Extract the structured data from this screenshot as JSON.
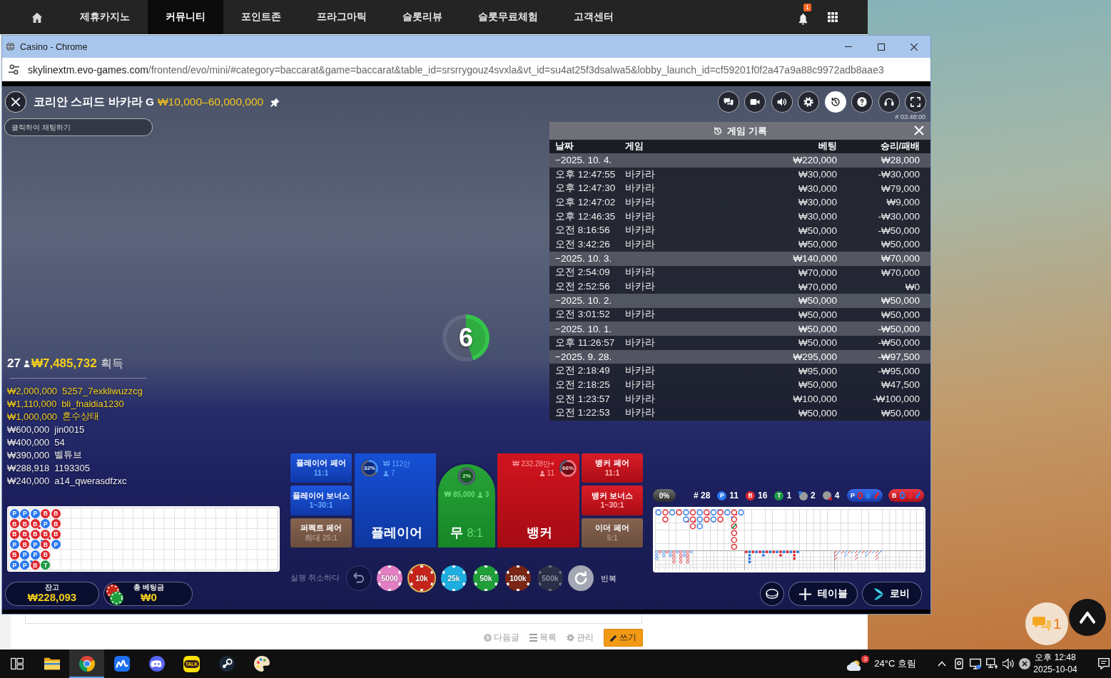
{
  "site_nav": {
    "items": [
      {
        "kind": "home",
        "selected": false
      },
      {
        "kind": "link",
        "label": "제휴카지노",
        "selected": false
      },
      {
        "kind": "link",
        "label": "커뮤니티",
        "selected": true
      },
      {
        "kind": "link",
        "label": "포인트존",
        "selected": false
      },
      {
        "kind": "link",
        "label": "프라그마틱",
        "selected": false
      },
      {
        "kind": "link",
        "label": "슬롯리뷰",
        "selected": false
      },
      {
        "kind": "link",
        "label": "슬롯무료체험",
        "selected": false
      },
      {
        "kind": "link",
        "label": "고객센터",
        "selected": false
      }
    ],
    "notification_count": "1"
  },
  "browser": {
    "title": "Casino - Chrome",
    "url": {
      "host": "skylinextm.evo-games.com",
      "path": "/frontend/evo/mini/#category=baccarat&game=baccarat&table_id=srsrrygouz4svxla&vt_id=su4at25f3dsalwa5&lobby_launch_id=cf59201f0f2a47a9a88c9972adb8aae3"
    }
  },
  "game": {
    "title": "코리안 스피드 바카라 G",
    "limits": "₩10,000–60,000,000",
    "toolbar": [
      {
        "kind": "chat",
        "selected": false
      },
      {
        "kind": "video",
        "selected": false
      },
      {
        "kind": "sound",
        "selected": false
      },
      {
        "kind": "settings",
        "selected": false
      },
      {
        "kind": "history",
        "selected": true
      },
      {
        "kind": "help",
        "selected": false
      },
      {
        "kind": "support",
        "selected": false
      },
      {
        "kind": "fullscreen",
        "selected": false
      }
    ],
    "round_id": "# 03:48:00",
    "chat_input": {
      "placeholder": "클릭하여 채팅하기"
    },
    "history": {
      "title": "게임 기록",
      "columns": [
        "날짜",
        "게임",
        "베팅",
        "승리/패배"
      ],
      "rows": [
        {
          "kind": "date",
          "date": "−2025. 10. 4.",
          "bet": "₩220,000",
          "result": "₩28,000"
        },
        {
          "kind": "game",
          "time": "오후 12:47:55",
          "game": "바카라",
          "bet": "₩30,000",
          "result": "-₩30,000"
        },
        {
          "kind": "game",
          "time": "오후 12:47:30",
          "game": "바카라",
          "bet": "₩30,000",
          "result": "₩79,000"
        },
        {
          "kind": "game",
          "time": "오후 12:47:02",
          "game": "바카라",
          "bet": "₩30,000",
          "result": "₩9,000"
        },
        {
          "kind": "game",
          "time": "오후 12:46:35",
          "game": "바카라",
          "bet": "₩30,000",
          "result": "-₩30,000"
        },
        {
          "kind": "game",
          "time": "오전 8:16:56",
          "game": "바카라",
          "bet": "₩50,000",
          "result": "-₩50,000"
        },
        {
          "kind": "game",
          "time": "오전 3:42:26",
          "game": "바카라",
          "bet": "₩50,000",
          "result": "₩50,000"
        },
        {
          "kind": "date",
          "date": "−2025. 10. 3.",
          "bet": "₩140,000",
          "result": "₩70,000"
        },
        {
          "kind": "game",
          "time": "오전 2:54:09",
          "game": "바카라",
          "bet": "₩70,000",
          "result": "₩70,000"
        },
        {
          "kind": "game",
          "time": "오전 2:52:56",
          "game": "바카라",
          "bet": "₩70,000",
          "result": "₩0"
        },
        {
          "kind": "date",
          "date": "−2025. 10. 2.",
          "bet": "₩50,000",
          "result": "₩50,000"
        },
        {
          "kind": "game",
          "time": "오전 3:01:52",
          "game": "바카라",
          "bet": "₩50,000",
          "result": "₩50,000"
        },
        {
          "kind": "date",
          "date": "−2025. 10. 1.",
          "bet": "₩50,000",
          "result": "-₩50,000"
        },
        {
          "kind": "game",
          "time": "오후 11:26:57",
          "game": "바카라",
          "bet": "₩50,000",
          "result": "-₩50,000"
        },
        {
          "kind": "date",
          "date": "−2025. 9. 28.",
          "bet": "₩295,000",
          "result": "-₩97,500"
        },
        {
          "kind": "game",
          "time": "오전 2:18:49",
          "game": "바카라",
          "bet": "₩95,000",
          "result": "-₩95,000"
        },
        {
          "kind": "game",
          "time": "오전 2:18:25",
          "game": "바카라",
          "bet": "₩50,000",
          "result": "₩47,500"
        },
        {
          "kind": "game",
          "time": "오전 1:23:57",
          "game": "바카라",
          "bet": "₩100,000",
          "result": "-₩100,000"
        },
        {
          "kind": "game",
          "time": "오전 1:22:53",
          "game": "바카라",
          "bet": "₩50,000",
          "result": "₩50,000"
        }
      ]
    },
    "timer": {
      "seconds": "6",
      "level": 0.45
    },
    "winners": {
      "count": "27",
      "total": "₩7,485,732",
      "label": "획득",
      "list": [
        {
          "amount": "₩2,000,000",
          "name": "5257_7exkliwuzzcg",
          "highlight": true
        },
        {
          "amount": "₩1,110,000",
          "name": "bli_fnaldia1230",
          "highlight": true
        },
        {
          "amount": "₩1,000,000",
          "name": "혼수상태",
          "highlight": true
        },
        {
          "amount": "₩600,000",
          "name": "jin0015",
          "highlight": false
        },
        {
          "amount": "₩400,000",
          "name": "54",
          "highlight": false
        },
        {
          "amount": "₩390,000",
          "name": "벨튜브",
          "highlight": false
        },
        {
          "amount": "₩288,918",
          "name": "1193305",
          "highlight": false
        },
        {
          "amount": "₩240,000",
          "name": "a14_qwerasdfzxc",
          "highlight": false
        }
      ]
    },
    "bead_road": [
      {
        "kind": "player",
        "text": "P",
        "banker_pair": false,
        "player_pair": false
      },
      {
        "kind": "banker",
        "text": "B",
        "banker_pair": false,
        "player_pair": false
      },
      {
        "kind": "banker",
        "text": "B",
        "banker_pair": false,
        "player_pair": false
      },
      {
        "kind": "player",
        "text": "P",
        "banker_pair": false,
        "player_pair": false
      },
      {
        "kind": "banker",
        "text": "B",
        "banker_pair": false,
        "player_pair": false
      },
      {
        "kind": "player",
        "text": "P",
        "banker_pair": false,
        "player_pair": false
      },
      {
        "kind": "player",
        "text": "P",
        "banker_pair": true,
        "player_pair": false
      },
      {
        "kind": "banker",
        "text": "B",
        "banker_pair": false,
        "player_pair": false
      },
      {
        "kind": "banker",
        "text": "B",
        "banker_pair": true,
        "player_pair": false
      },
      {
        "kind": "banker",
        "text": "B",
        "banker_pair": false,
        "player_pair": false
      },
      {
        "kind": "player",
        "text": "P",
        "banker_pair": false,
        "player_pair": false
      },
      {
        "kind": "player",
        "text": "P",
        "banker_pair": false,
        "player_pair": false
      },
      {
        "kind": "player",
        "text": "P",
        "banker_pair": false,
        "player_pair": false
      },
      {
        "kind": "banker",
        "text": "B",
        "banker_pair": true,
        "player_pair": false
      },
      {
        "kind": "banker",
        "text": "B",
        "banker_pair": false,
        "player_pair": false
      },
      {
        "kind": "player",
        "text": "P",
        "banker_pair": false,
        "player_pair": false
      },
      {
        "kind": "player",
        "text": "P",
        "banker_pair": false,
        "player_pair": false
      },
      {
        "kind": "banker",
        "text": "B",
        "banker_pair": false,
        "player_pair": true
      },
      {
        "kind": "banker",
        "text": "B",
        "banker_pair": false,
        "player_pair": false
      },
      {
        "kind": "player",
        "text": "P",
        "banker_pair": false,
        "player_pair": false
      },
      {
        "kind": "banker",
        "text": "B",
        "banker_pair": true,
        "player_pair": false
      },
      {
        "kind": "banker",
        "text": "B",
        "banker_pair": false,
        "player_pair": true
      },
      {
        "kind": "banker",
        "text": "B",
        "banker_pair": false,
        "player_pair": false
      },
      {
        "kind": "tie",
        "text": "T",
        "banker_pair": false,
        "player_pair": false
      },
      {
        "kind": "banker",
        "text": "B",
        "banker_pair": false,
        "player_pair": false
      },
      {
        "kind": "banker",
        "text": "B",
        "banker_pair": false,
        "player_pair": false
      },
      {
        "kind": "banker",
        "text": "B",
        "banker_pair": false,
        "player_pair": false
      },
      {
        "kind": "player",
        "text": "P",
        "banker_pair": false,
        "player_pair": false
      }
    ],
    "balance": {
      "label": "잔고",
      "value": "₩228,093"
    },
    "total_bet": {
      "label": "총 베팅금",
      "value": "₩0"
    },
    "bets": {
      "left": [
        {
          "kind": "player",
          "label": "플레이어 페어",
          "odds": "11:1"
        },
        {
          "kind": "player",
          "label": "플레이어 보너스",
          "odds": "1~30:1"
        },
        {
          "kind": "neutral",
          "label": "퍼펙트 페어",
          "odds": "최대 25:1"
        }
      ],
      "player": {
        "label": "플레이어",
        "share": "32%",
        "level": 0.32,
        "amount": "₩ 112만",
        "bettors": "7"
      },
      "tie": {
        "label": "무",
        "odds": "8:1",
        "share": "2%",
        "amount": "₩ 85,000",
        "bettors": "3"
      },
      "banker": {
        "label": "뱅커",
        "share": "66%",
        "level": 0.66,
        "amount": "₩ 232.28만+",
        "bettors": "11"
      },
      "right": [
        {
          "kind": "banker",
          "label": "뱅커 페어",
          "odds": "11:1"
        },
        {
          "kind": "banker",
          "label": "뱅커 보너스",
          "odds": "1~30:1"
        },
        {
          "kind": "neutral",
          "label": "이더 페어",
          "odds": "5:1"
        }
      ]
    },
    "undo_label": "실행 취소하다",
    "chips": [
      {
        "label": "5000",
        "color": "#e27fc2",
        "selected": false,
        "disabled": false
      },
      {
        "label": "10k",
        "color": "#c4241a",
        "selected": true,
        "disabled": false
      },
      {
        "label": "25k",
        "color": "#1eaee0",
        "selected": false,
        "disabled": false
      },
      {
        "label": "50k",
        "color": "#1f9e3a",
        "selected": false,
        "disabled": false
      },
      {
        "label": "100k",
        "color": "#7a2616",
        "selected": false,
        "disabled": false
      },
      {
        "label": "500k",
        "color": "#2b2f48",
        "selected": false,
        "disabled": true
      }
    ],
    "repeat_label": "반복",
    "stats": {
      "percent": "0%",
      "round": "# 28",
      "counts": [
        {
          "kind": "player",
          "letter": "P",
          "count": "11"
        },
        {
          "kind": "banker",
          "letter": "B",
          "count": "16"
        },
        {
          "kind": "tie",
          "letter": "T",
          "count": "1"
        },
        {
          "kind": "player_pair",
          "count": "2"
        },
        {
          "kind": "banker_pair",
          "count": "4"
        }
      ],
      "predictions": [
        {
          "kind": "player",
          "letter": "P",
          "marks": [
            {
              "kind": "ring",
              "color": "#e0262e"
            },
            {
              "kind": "dot",
              "color": "#2a78ee"
            },
            {
              "kind": "slash",
              "color": "#e0262e"
            }
          ]
        },
        {
          "kind": "banker",
          "letter": "B",
          "marks": [
            {
              "kind": "ring",
              "color": "#2a78ee"
            },
            {
              "kind": "dot",
              "color": "#e0262e"
            },
            {
              "kind": "slash",
              "color": "#2a78ee"
            }
          ]
        }
      ]
    },
    "buttons": [
      {
        "kind": "table_view"
      },
      {
        "kind": "add_table",
        "label": "테이블"
      },
      {
        "kind": "lobby",
        "label": "로비"
      }
    ]
  },
  "post_actions": [
    {
      "kind": "next",
      "label": "다음글"
    },
    {
      "kind": "list",
      "label": "목록"
    },
    {
      "kind": "manage",
      "label": "관리"
    },
    {
      "kind": "write",
      "label": "쓰기"
    }
  ],
  "floating_chat": {
    "count": "1"
  },
  "taskbar": {
    "apps": [
      {
        "kind": "task_view",
        "selected": false
      },
      {
        "kind": "explorer",
        "selected": false
      },
      {
        "kind": "browser",
        "selected": true
      },
      {
        "kind": "wave",
        "selected": false
      },
      {
        "kind": "discord",
        "selected": false
      },
      {
        "kind": "talk",
        "label": "TALK",
        "selected": false
      },
      {
        "kind": "steam",
        "selected": false
      },
      {
        "kind": "paint",
        "selected": false
      }
    ],
    "weather": {
      "badge": "3",
      "text": "24°C 흐림"
    },
    "time": "오후 12:48",
    "date": "2025-10-04"
  }
}
